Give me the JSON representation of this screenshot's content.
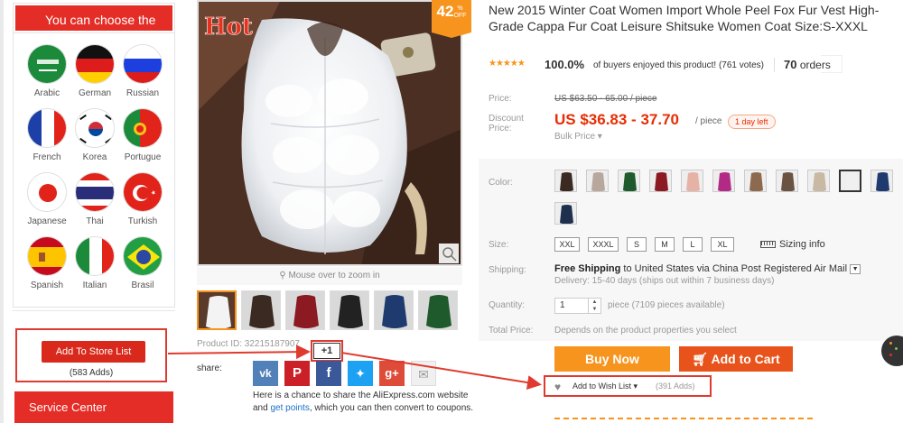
{
  "languages": {
    "header": "You can choose the",
    "items": [
      {
        "label": "Arabic",
        "icon": "saudi-flag-icon"
      },
      {
        "label": "German",
        "icon": "german-flag-icon"
      },
      {
        "label": "Russian",
        "icon": "russian-flag-icon"
      },
      {
        "label": "French",
        "icon": "french-flag-icon"
      },
      {
        "label": "Korea",
        "icon": "korean-flag-icon"
      },
      {
        "label": "Portugue",
        "icon": "portuguese-flag-icon"
      },
      {
        "label": "Japanese",
        "icon": "japanese-flag-icon"
      },
      {
        "label": "Thai",
        "icon": "thai-flag-icon"
      },
      {
        "label": "Turkish",
        "icon": "turkish-flag-icon"
      },
      {
        "label": "Spanish",
        "icon": "spanish-flag-icon"
      },
      {
        "label": "Italian",
        "icon": "italian-flag-icon"
      },
      {
        "label": "Brasil",
        "icon": "brazilian-flag-icon"
      }
    ]
  },
  "store": {
    "add_label": "Add To Store List",
    "adds": "(583 Adds)"
  },
  "service_center": "Service Center",
  "gallery": {
    "hot_label": "Hot",
    "discount_pct": "42",
    "discount_pct_sign": "%",
    "discount_off": "OFF",
    "zoom_hint": "Mouse over to zoom in",
    "thumb_count": 6
  },
  "product_id": "Product ID: 32215187907",
  "plus_one": "+1",
  "share": {
    "label": "share:",
    "icons": [
      "vk-icon",
      "pinterest-icon",
      "facebook-icon",
      "twitter-icon",
      "google-plus-icon",
      "email-icon"
    ],
    "text_before": "Here is a chance to share the AliExpress.com website and ",
    "link": "get points",
    "text_after": ", which you can then convert to coupons."
  },
  "product": {
    "title": "New 2015 Winter Coat Women Import Whole Peel Fox Fur Vest High-Grade Cappa Fur Coat Leisure Shitsuke Women Coat Size:S-XXXL",
    "rating_pct": "100.0%",
    "enjoyed": "of buyers enjoyed this product! (761 votes)",
    "orders_count": "70",
    "orders_label": "orders"
  },
  "price": {
    "label": "Price:",
    "original": "US $63.50 - 65.00 / piece",
    "discount_label_1": "Discount",
    "discount_label_2": "Price:",
    "current": "US $36.83 - 37.70",
    "unit": "/ piece",
    "days_left": "1 day left",
    "bulk": "Bulk Price ▾"
  },
  "options": {
    "color_label": "Color:",
    "color_count": 12,
    "selected_color_index": 9,
    "size_label": "Size:",
    "sizes": [
      "XXL",
      "XXXL",
      "S",
      "M",
      "L",
      "XL"
    ],
    "size_info": "Sizing info"
  },
  "shipping": {
    "label": "Shipping:",
    "free": "Free Shipping",
    "rest": " to  United States via China Post Registered Air Mail",
    "delivery": "Delivery: 15-40 days (ships out within 7 business days)"
  },
  "quantity": {
    "label": "Quantity:",
    "value": "1",
    "available": "piece (7109 pieces available)"
  },
  "total": {
    "label": "Total Price:",
    "value": "Depends on the product properties you select"
  },
  "actions": {
    "buy_now": "Buy Now",
    "add_to_cart": "Add to Cart",
    "wish_label": "Add to Wish List",
    "wish_count": "(391 Adds)"
  },
  "colors": {
    "accent_red": "#e52d27",
    "price_red": "#e62e04",
    "buy_orange": "#f7941d",
    "cart_orange": "#e8531b",
    "arrow_red": "#e03a2f"
  }
}
